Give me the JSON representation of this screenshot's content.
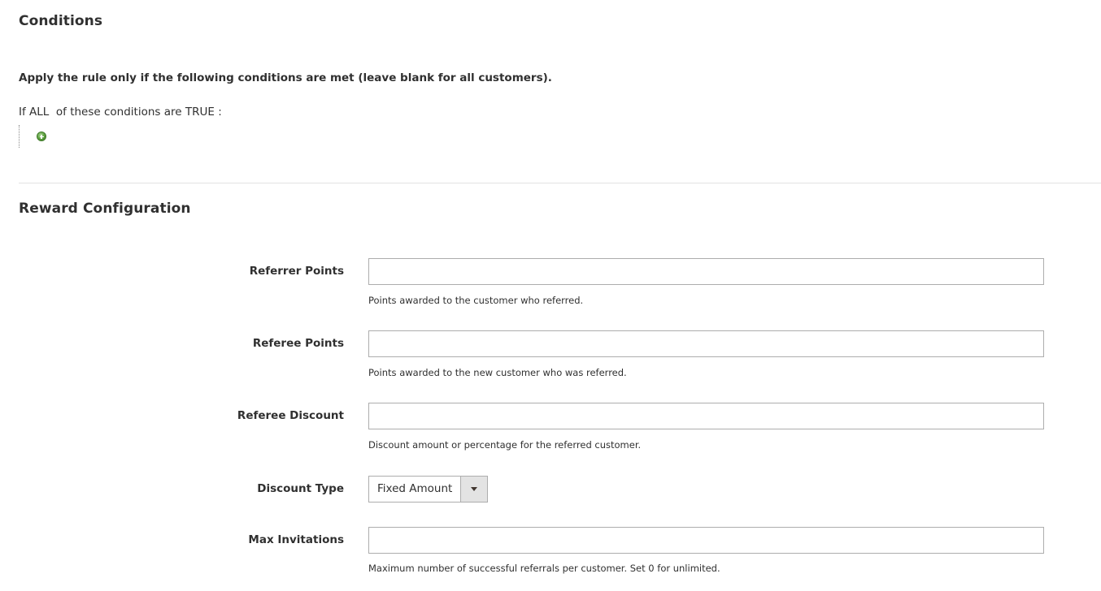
{
  "conditions": {
    "title": "Conditions",
    "intro": "Apply the rule only if the following conditions are met (leave blank for all customers).",
    "rule": {
      "prefix": "If ",
      "aggregator": "ALL",
      "middle": "  of these conditions are ",
      "value": "TRUE",
      "suffix": " :"
    },
    "add_icon": "add-circle-icon"
  },
  "reward": {
    "title": "Reward Configuration",
    "fields": {
      "referrer_points": {
        "label": "Referrer Points",
        "value": "",
        "note": "Points awarded to the customer who referred."
      },
      "referee_points": {
        "label": "Referee Points",
        "value": "",
        "note": "Points awarded to the new customer who was referred."
      },
      "referee_discount": {
        "label": "Referee Discount",
        "value": "",
        "note": "Discount amount or percentage for the referred customer."
      },
      "discount_type": {
        "label": "Discount Type",
        "selected": "Fixed Amount",
        "arrow_icon": "chevron-down-icon"
      },
      "max_invitations": {
        "label": "Max Invitations",
        "value": "",
        "note": "Maximum number of successful referrals per customer. Set 0 for unlimited."
      }
    }
  },
  "colors": {
    "text": "#303030",
    "input_border": "#adadad",
    "divider": "#e3e3e3",
    "select_button_bg": "#e3e3e3",
    "add_icon_green": "#5a9e3c"
  }
}
